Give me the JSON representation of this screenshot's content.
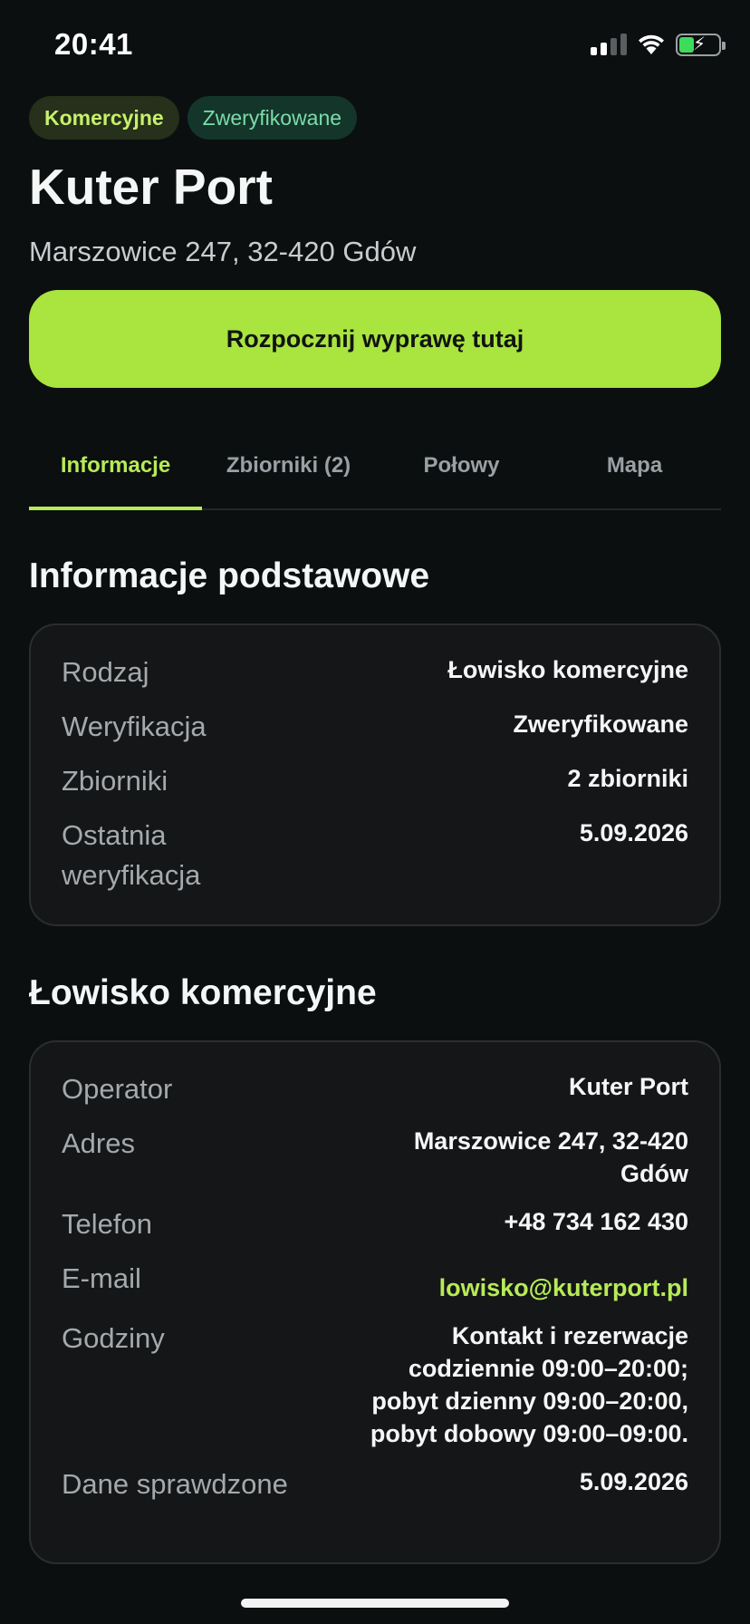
{
  "status": {
    "time": "20:41"
  },
  "badges": {
    "commercial": "Komercyjne",
    "verified": "Zweryfikowane"
  },
  "header": {
    "title": "Kuter Port",
    "address": "Marszowice 247, 32-420 Gdów"
  },
  "cta": {
    "label": "Rozpocznij wyprawę tutaj"
  },
  "tabs": [
    {
      "label": "Informacje",
      "active": true
    },
    {
      "label": "Zbiorniki (2)",
      "active": false
    },
    {
      "label": "Połowy",
      "active": false
    },
    {
      "label": "Mapa",
      "active": false
    }
  ],
  "basic_info": {
    "title": "Informacje podstawowe",
    "rows": [
      {
        "key": "Rodzaj",
        "value": "Łowisko komercyjne"
      },
      {
        "key": "Weryfikacja",
        "value": "Zweryfikowane"
      },
      {
        "key": "Zbiorniki",
        "value": "2 zbiorniki"
      },
      {
        "key": "Ostatnia weryfikacja",
        "value": "5.09.2026"
      }
    ]
  },
  "commercial": {
    "title": "Łowisko komercyjne",
    "rows": [
      {
        "key": "Operator",
        "value": "Kuter Port"
      },
      {
        "key": "Adres",
        "value": "Marszowice 247, 32-420 Gdów"
      },
      {
        "key": "Telefon",
        "value": "+48 734 162 430"
      },
      {
        "key": "E-mail",
        "value": "lowisko@kuterport.pl"
      },
      {
        "key": "Godziny",
        "value": "Kontakt i rezerwacje codziennie 09:00–20:00; pobyt dzienny 09:00–20:00, pobyt dobowy 09:00–09:00."
      },
      {
        "key": "Dane sprawdzone",
        "value": "5.09.2026"
      }
    ]
  },
  "colors": {
    "accent": "#b7ea58",
    "cta": "#a9e43f",
    "background": "#0b0f10",
    "card": "#141618"
  }
}
